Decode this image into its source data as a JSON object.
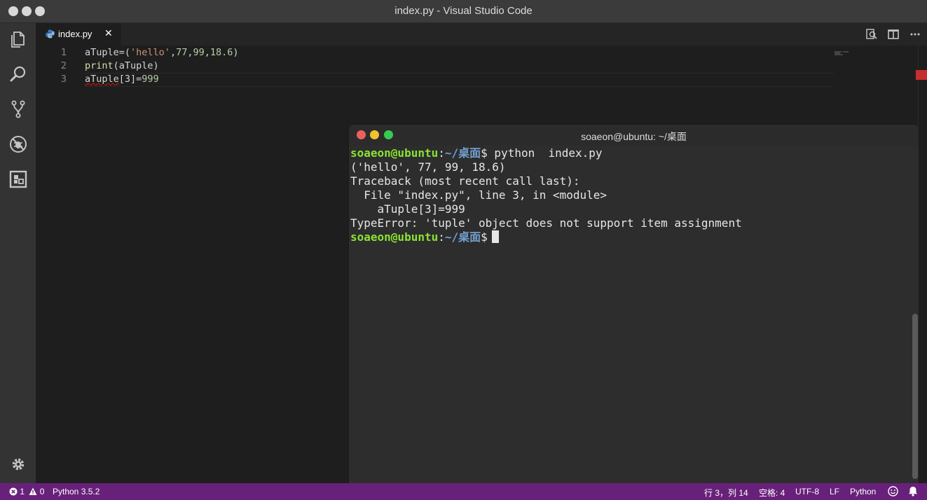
{
  "window": {
    "title": "index.py - Visual Studio Code"
  },
  "activity_bar": {
    "items": [
      {
        "name": "explorer-icon"
      },
      {
        "name": "search-icon"
      },
      {
        "name": "source-control-icon"
      },
      {
        "name": "debug-icon"
      },
      {
        "name": "extensions-icon"
      }
    ],
    "settings": "gear-icon"
  },
  "tab": {
    "label": "index.py",
    "close": "✕",
    "icon": "python-icon"
  },
  "editor": {
    "lines": [
      {
        "number": "1",
        "parts": {
          "a": "aTuple=(",
          "b": "'hello'",
          "c": ",",
          "d": "77",
          "e": ",",
          "f": "99",
          "g": ",",
          "h": "18.6",
          "i": ")"
        }
      },
      {
        "number": "2",
        "parts": {
          "a": "print",
          "b": "(aTuple)"
        }
      },
      {
        "number": "3",
        "parts": {
          "a": "aTuple",
          "b": "[3]=",
          "c": "999"
        }
      }
    ]
  },
  "terminal": {
    "title": "soaeon@ubuntu: ~/桌面",
    "prompt_user": "soaeon@ubuntu",
    "prompt_colon": ":",
    "prompt_path": "~/桌面",
    "prompt_symbol": "$ ",
    "command": "python  index.py",
    "output": [
      "('hello', 77, 99, 18.6)",
      "Traceback (most recent call last):",
      "  File \"index.py\", line 3, in <module>",
      "    aTuple[3]=999",
      "TypeError: 'tuple' object does not support item assignment"
    ]
  },
  "status_bar": {
    "errors": "1",
    "warnings": "0",
    "interpreter": "Python 3.5.2",
    "position": "行 3，列 14",
    "spaces": "空格: 4",
    "encoding": "UTF-8",
    "eol": "LF",
    "language": "Python"
  },
  "colors": {
    "status_bar": "#68217a",
    "terminal_user": "#8ae234",
    "terminal_path": "#729fcf",
    "error": "#e51400"
  }
}
